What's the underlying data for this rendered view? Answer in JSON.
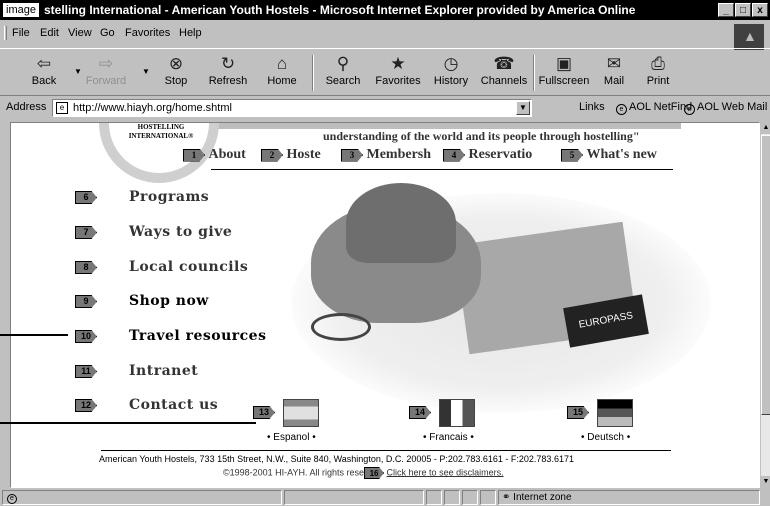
{
  "window": {
    "tag": "image",
    "title": "stelling International - American Youth Hostels - Microsoft Internet Explorer provided by America Online",
    "buttons": [
      "_",
      "□",
      "x"
    ]
  },
  "menu": [
    "File",
    "Edit",
    "View",
    "Go",
    "Favorites",
    "Help"
  ],
  "toolbar": {
    "back": "Back",
    "forward": "Forward",
    "stop": "Stop",
    "refresh": "Refresh",
    "home": "Home",
    "search": "Search",
    "favorites": "Favorites",
    "history": "History",
    "channels": "Channels",
    "fullscreen": "Fullscreen",
    "mail": "Mail",
    "print": "Print"
  },
  "address": {
    "label": "Address",
    "url": "http://www.hiayh.org/home.shtml",
    "links_label": "Links",
    "links": [
      "AOL NetFind",
      "AOL Web Mail"
    ]
  },
  "page": {
    "logo_text": "HOSTELLING INTERNATIONAL®",
    "tagline": "understanding of the world and its people through hostelling\"",
    "top_nav": [
      {
        "num": "1",
        "label": "About"
      },
      {
        "num": "2",
        "label": "Hoste"
      },
      {
        "num": "3",
        "label": "Membersh"
      },
      {
        "num": "4",
        "label": "Reservatio"
      },
      {
        "num": "5",
        "label": "What's new"
      }
    ],
    "side_nav": [
      {
        "num": "6",
        "label": "Programs"
      },
      {
        "num": "7",
        "label": "Ways to give"
      },
      {
        "num": "8",
        "label": "Local councils"
      },
      {
        "num": "9",
        "label": "Shop now"
      },
      {
        "num": "10",
        "label": "Travel resources"
      },
      {
        "num": "11",
        "label": "Intranet"
      },
      {
        "num": "12",
        "label": "Contact us"
      }
    ],
    "languages": [
      {
        "num": "13",
        "label": "• Espanol •"
      },
      {
        "num": "14",
        "label": "• Francais •"
      },
      {
        "num": "15",
        "label": "• Deutsch •"
      }
    ],
    "photo_label": "EUROPASS",
    "footer_address": "American Youth Hostels, 733 15th Street, N.W., Suite 840, Washington, D.C. 20005  -  P:202.783.6161  -  F:202.783.6171",
    "copyright": "©1998-2001 HI-AYH. All rights rese",
    "footer_num": "16",
    "disclaimer": "Click here to see disclaimers."
  },
  "status": {
    "zone": "Internet zone"
  }
}
